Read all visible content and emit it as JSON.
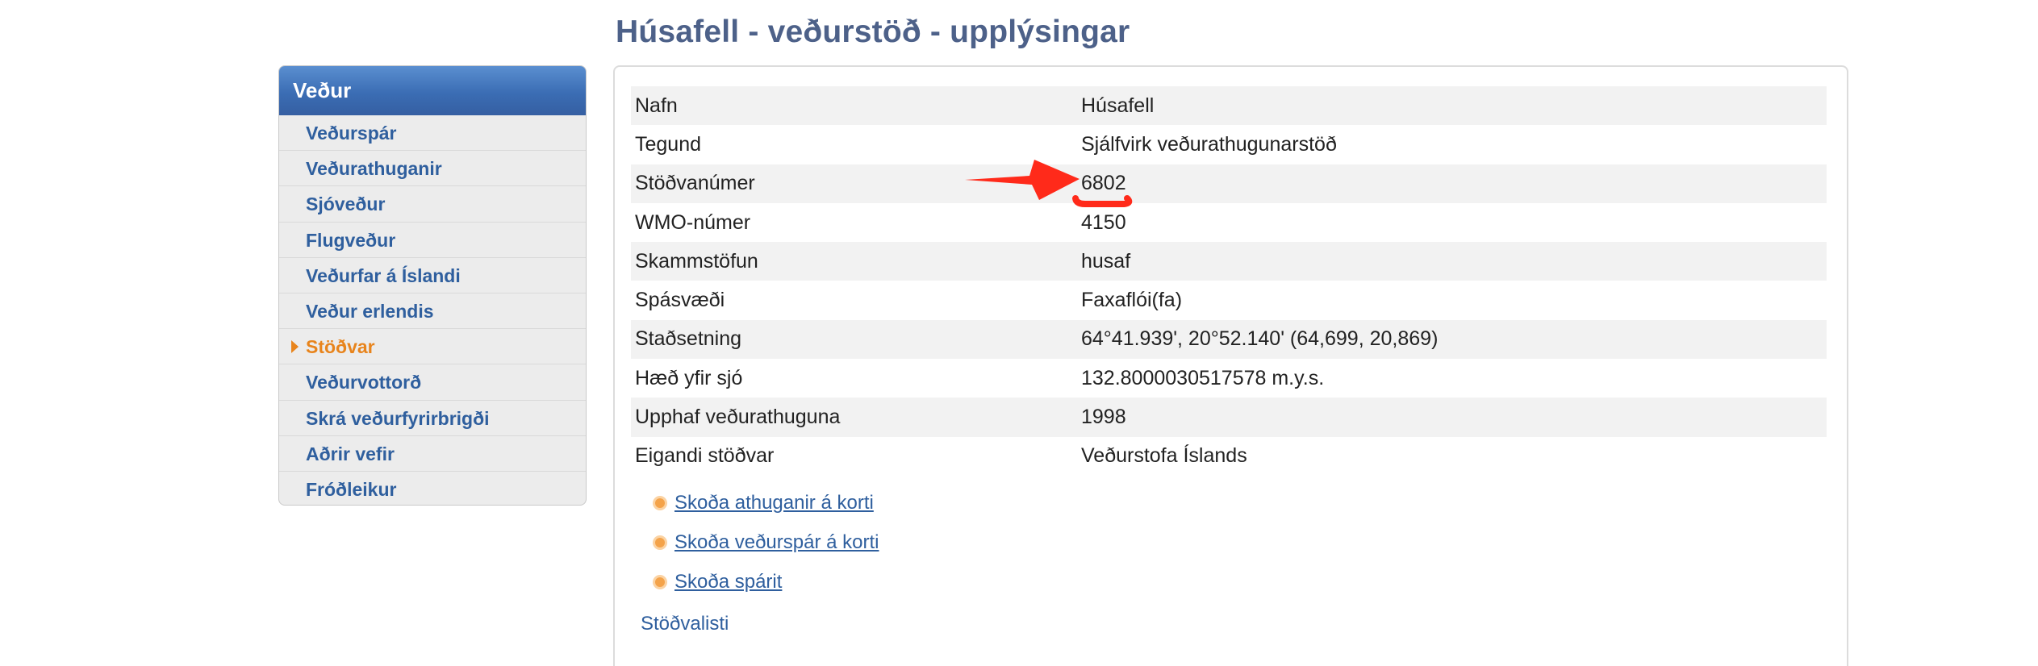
{
  "page": {
    "title": "Húsafell - veðurstöð - upplýsingar"
  },
  "sidebar": {
    "header": "Veður",
    "items": [
      {
        "label": "Veðurspár"
      },
      {
        "label": "Veðurathuganir"
      },
      {
        "label": "Sjóveður"
      },
      {
        "label": "Flugveður"
      },
      {
        "label": "Veðurfar á Íslandi"
      },
      {
        "label": "Veður erlendis"
      },
      {
        "label": "Stöðvar",
        "active": true
      },
      {
        "label": "Veðurvottorð"
      },
      {
        "label": "Skrá veðurfyrirbrigði"
      },
      {
        "label": "Aðrir vefir"
      },
      {
        "label": "Fróðleikur"
      }
    ]
  },
  "station": {
    "rows": [
      {
        "label": "Nafn",
        "value": "Húsafell"
      },
      {
        "label": "Tegund",
        "value": "Sjálfvirk veðurathugunarstöð"
      },
      {
        "label": "Stöðvanúmer",
        "value": "6802"
      },
      {
        "label": "WMO-númer",
        "value": "4150"
      },
      {
        "label": "Skammstöfun",
        "value": "husaf"
      },
      {
        "label": "Spásvæði",
        "value": "Faxaflói(fa)"
      },
      {
        "label": "Staðsetning",
        "value": "64°41.939', 20°52.140' (64,699, 20,869)"
      },
      {
        "label": "Hæð yfir sjó",
        "value": "132.8000030517578 m.y.s."
      },
      {
        "label": "Upphaf veðurathuguna",
        "value": "1998"
      },
      {
        "label": "Eigandi stöðvar",
        "value": "Veðurstofa Íslands"
      }
    ]
  },
  "links": [
    {
      "label": "Skoða athuganir á korti"
    },
    {
      "label": "Skoða veðurspár á korti"
    },
    {
      "label": "Skoða spárit"
    }
  ],
  "station_list_label": "Stöðvalisti",
  "colors": {
    "title": "#4d6189",
    "link": "#2f5f9e",
    "active": "#e8841c",
    "header_bg": "#3b6db4",
    "annotation": "#ff2a1a"
  },
  "annotation": {
    "type": "red-arrow-and-underline",
    "target": "station.rows.2.value"
  }
}
